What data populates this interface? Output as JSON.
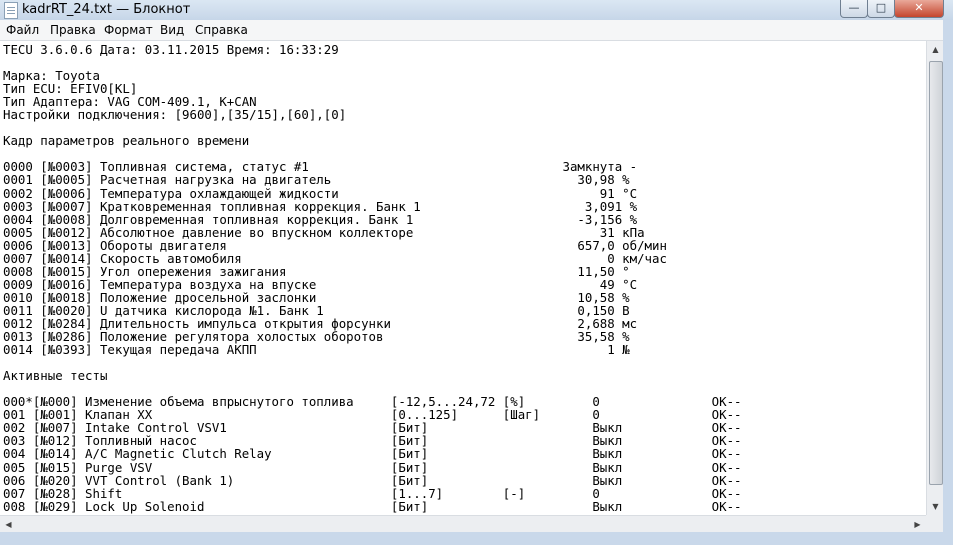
{
  "window": {
    "title": "kadrRT_24.txt — Блокнот",
    "minimize_glyph": "—",
    "maximize_glyph": "□",
    "close_glyph": "✕",
    "app_icon": "notepad-icon"
  },
  "menu": {
    "file": "Файл",
    "edit": "Правка",
    "format": "Формат",
    "view": "Вид",
    "help": "Справка"
  },
  "document": {
    "lines": [
      "TECU 3.6.0.6 Дата: 03.11.2015 Время: 16:33:29",
      "",
      "Марка: Toyota",
      "Тип ECU: EFIV0[KL]",
      "Тип Адаптера: VAG COM-409.1, K+CAN",
      "Настройки подключения: [9600],[35/15],[60],[0]",
      "",
      "Кадр параметров реального времени",
      "",
      "0000 [№0003] Топливная система, статус #1                                  Замкнута -",
      "0001 [№0005] Расчетная нагрузка на двигатель                                 30,98 %",
      "0002 [№0006] Температура охлаждающей жидкости                                   91 °C",
      "0003 [№0007] Кратковременная топливная коррекция. Банк 1                      3,091 %",
      "0004 [№0008] Долговременная топливная коррекция. Банк 1                      -3,156 %",
      "0005 [№0012] Абсолютное давление во впускном коллекторе                         31 кПа",
      "0006 [№0013] Обороты двигателя                                               657,0 об/мин",
      "0007 [№0014] Скорость автомобиля                                                 0 км/час",
      "0008 [№0015] Угол опережения зажигания                                       11,50 °",
      "0009 [№0016] Температура воздуха на впуске                                      49 °C",
      "0010 [№0018] Положение дросельной заслонки                                   10,58 %",
      "0011 [№0020] U датчика кислорода №1. Банк 1                                  0,150 В",
      "0012 [№0284] Длительность импульса открытия форсунки                         2,688 мс",
      "0013 [№0286] Положение регулятора холостых оборотов                          35,58 %",
      "0014 [№0393] Текущая передача АКПП                                               1 №",
      "",
      "Активные тесты",
      "",
      "000*[№000] Изменение объема впрыснутого топлива     [-12,5...24,72 [%]         0               OK--",
      "001 [№001] Клапан XX                                [0...125]      [Шаг]       0               OK--",
      "002 [№007] Intake Control VSV1                      [Бит]                      Выкл            OK--",
      "003 [№012] Топливный насос                          [Бит]                      Выкл            OK--",
      "004 [№014] A/C Magnetic Clutch Relay                [Бит]                      Выкл            OK--",
      "005 [№015] Purge VSV                                [Бит]                      Выкл            OK--",
      "006 [№020] VVT Control (Bank 1)                     [Бит]                      Выкл            OK--",
      "007 [№028] Shift                                    [1...7]        [-]         0               OK--",
      "008 [№029] Lock Up Solenoid                         [Бит]                      Выкл            OK--"
    ]
  },
  "scrollbars": {
    "up": "▲",
    "down": "▼",
    "left": "◀",
    "right": "▶"
  }
}
